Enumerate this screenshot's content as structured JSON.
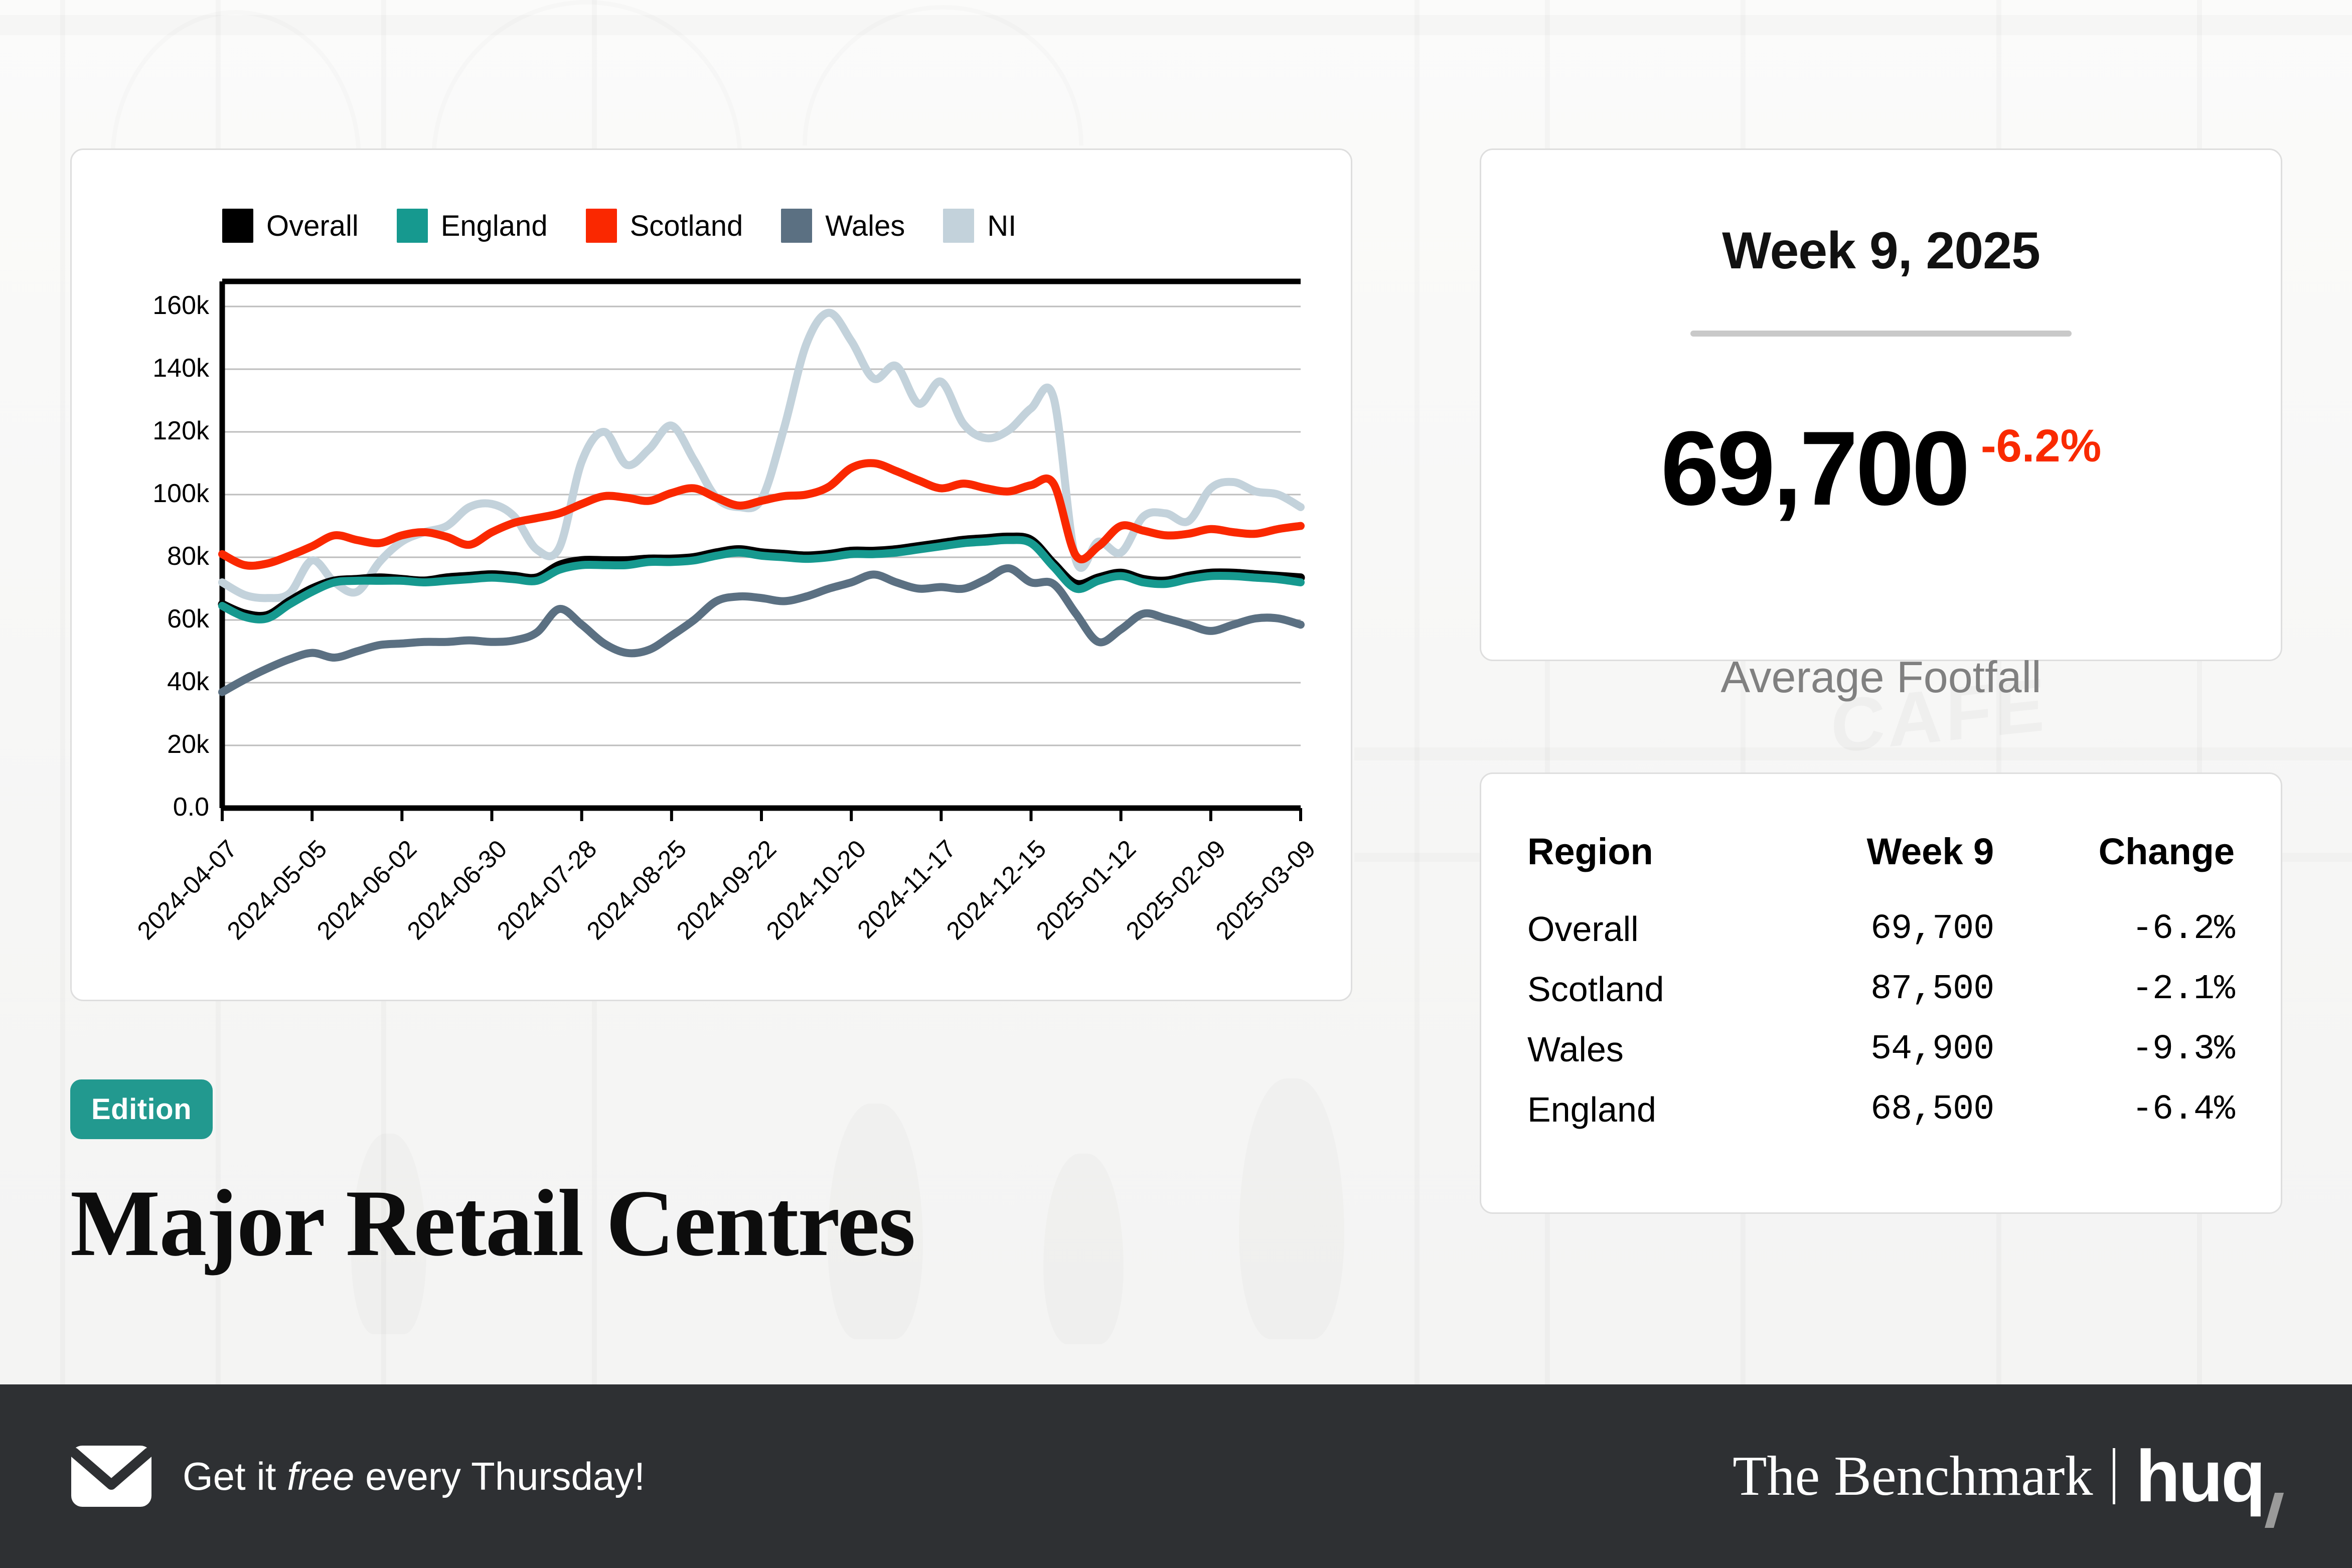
{
  "edition": {
    "badge_label": "Edition",
    "title": "Major Retail Centres"
  },
  "kpi": {
    "week_label": "Week 9, 2025",
    "value": "69,700",
    "delta": "-6.2%",
    "caption": "Average Footfall",
    "delta_color": "#f92a00"
  },
  "table": {
    "headers": [
      "Region",
      "Week 9",
      "Change"
    ],
    "rows": [
      {
        "region": "Overall",
        "week9": "69,700",
        "change": "-6.2%"
      },
      {
        "region": "Scotland",
        "week9": "87,500",
        "change": "-2.1%"
      },
      {
        "region": "Wales",
        "week9": "54,900",
        "change": "-9.3%"
      },
      {
        "region": "England",
        "week9": "68,500",
        "change": "-6.4%"
      }
    ]
  },
  "footer": {
    "cta_prefix": "Get it ",
    "cta_emphasis": "free",
    "cta_suffix": " every Thursday!",
    "brand_left": "The Benchmark",
    "brand_right": "huq",
    "mail_icon": "envelope-icon"
  },
  "chart_data": {
    "type": "line",
    "title": "",
    "xlabel": "",
    "ylabel": "",
    "ylim": [
      0,
      168000
    ],
    "ytick_values": [
      0,
      20000,
      40000,
      60000,
      80000,
      100000,
      120000,
      140000,
      160000
    ],
    "ytick_labels": [
      "0.0",
      "20k",
      "40k",
      "60k",
      "80k",
      "100k",
      "120k",
      "140k",
      "160k"
    ],
    "grid": true,
    "legend_position": "top-left",
    "xtick_labels": [
      "2024-04-07",
      "2024-05-05",
      "2024-06-02",
      "2024-06-30",
      "2024-07-28",
      "2024-08-25",
      "2024-09-22",
      "2024-10-20",
      "2024-11-17",
      "2024-12-15",
      "2025-01-12",
      "2025-02-09",
      "2025-03-09"
    ],
    "x_index_of_ticks": [
      0,
      4,
      8,
      12,
      16,
      20,
      24,
      28,
      32,
      36,
      40,
      44,
      48
    ],
    "series": [
      {
        "name": "Overall",
        "color": "#000000",
        "values": [
          65000,
          62000,
          61500,
          66000,
          70000,
          72500,
          73000,
          73500,
          73000,
          72500,
          73500,
          74000,
          74500,
          74000,
          73500,
          77500,
          79000,
          79000,
          79000,
          79500,
          79500,
          80000,
          81500,
          82500,
          81500,
          81000,
          80500,
          81000,
          82000,
          82000,
          82500,
          83500,
          84500,
          85500,
          86000,
          86500,
          85500,
          78000,
          71500,
          73500,
          75000,
          73000,
          72500,
          74000,
          75000,
          75000,
          74500,
          74000,
          73500
        ]
      },
      {
        "name": "England",
        "color": "#16998f",
        "values": [
          64500,
          61000,
          60500,
          65000,
          69000,
          72000,
          72500,
          72500,
          72500,
          72000,
          72500,
          73000,
          73500,
          73000,
          72500,
          76000,
          77500,
          77500,
          77500,
          78500,
          78500,
          79000,
          80500,
          81500,
          80500,
          80000,
          79500,
          80000,
          81000,
          81000,
          81500,
          82500,
          83500,
          84500,
          85000,
          85500,
          84500,
          77000,
          70000,
          72500,
          74000,
          72000,
          71500,
          73000,
          74000,
          74000,
          73500,
          73000,
          72000
        ]
      },
      {
        "name": "Scotland",
        "color": "#fa2800",
        "values": [
          81000,
          77500,
          78000,
          80500,
          83500,
          87000,
          85500,
          84500,
          87000,
          88000,
          86500,
          84000,
          88000,
          91000,
          92500,
          94000,
          97000,
          99500,
          99000,
          98000,
          100500,
          102000,
          99000,
          96500,
          98000,
          99500,
          100000,
          102500,
          108500,
          110000,
          107500,
          104500,
          102000,
          103500,
          102000,
          101000,
          103000,
          103500,
          80500,
          83500,
          90000,
          88500,
          87000,
          87500,
          89000,
          88000,
          87500,
          89000,
          90000
        ]
      },
      {
        "name": "Wales",
        "color": "#5b7082",
        "values": [
          37000,
          41000,
          44500,
          47500,
          49500,
          48000,
          50000,
          52000,
          52500,
          53000,
          53000,
          53500,
          53000,
          53500,
          56000,
          63500,
          58500,
          52500,
          49500,
          50500,
          55000,
          60000,
          66000,
          67500,
          67000,
          66000,
          67500,
          70000,
          72000,
          74500,
          72000,
          70000,
          70500,
          70000,
          73000,
          76500,
          72000,
          71500,
          62000,
          53000,
          57000,
          62000,
          60500,
          58500,
          56500,
          58500,
          60500,
          60500,
          58500
        ]
      },
      {
        "name": "NI",
        "color": "#c3d2db",
        "values": [
          72000,
          68000,
          67000,
          68500,
          79000,
          72000,
          69000,
          78500,
          85000,
          88000,
          90000,
          96000,
          97000,
          93000,
          82500,
          83000,
          110500,
          120000,
          109500,
          114500,
          122000,
          111000,
          99000,
          96000,
          98500,
          121000,
          148000,
          158000,
          149000,
          137000,
          141000,
          129000,
          136000,
          122500,
          118000,
          120500,
          127500,
          131000,
          79000,
          85000,
          81500,
          93000,
          94000,
          91500,
          102000,
          104000,
          101000,
          100000,
          96000
        ]
      }
    ]
  }
}
